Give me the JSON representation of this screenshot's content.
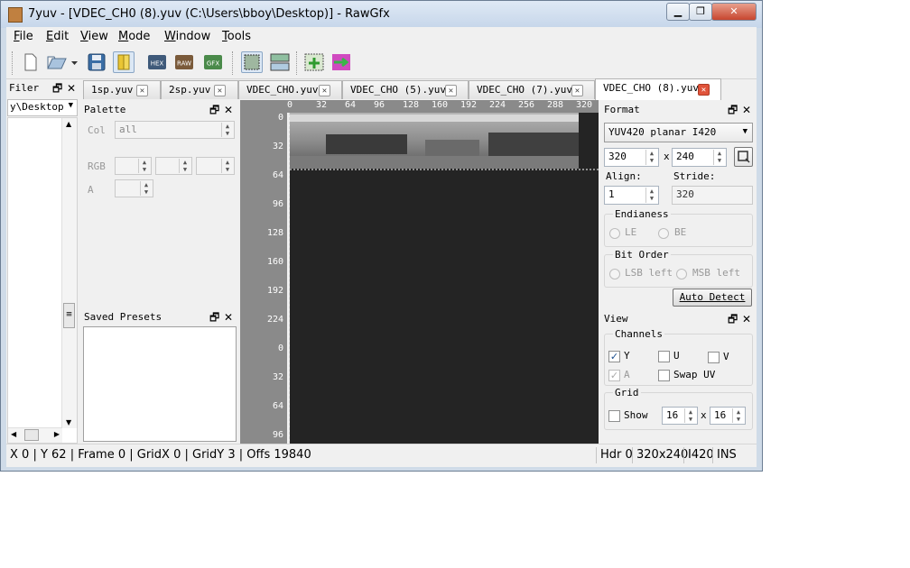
{
  "window": {
    "title": "7yuv - [VDEC_CH0 (8).yuv (C:\\Users\\bboy\\Desktop)] - RawGfx"
  },
  "menubar": {
    "items": [
      "File",
      "Edit",
      "View",
      "Mode",
      "Window",
      "Tools"
    ]
  },
  "toolbar": {
    "buttons": [
      "new-file-icon",
      "open-folder-icon",
      "dropdown-arrow-icon",
      "save-icon",
      "bookmark-icon",
      "hex-icon",
      "raw-icon",
      "gfx-icon",
      "grid-dots-icon",
      "compare-icon",
      "add-frame-icon",
      "convert-icon"
    ],
    "hex_label": "HEX",
    "raw_label": "RAW",
    "gfx_label": "GFX"
  },
  "filer": {
    "title": "Filer",
    "path": "y\\Desktop"
  },
  "palette": {
    "title": "Palette",
    "col_label": "Col",
    "col_value": "all",
    "rgb_label": "RGB",
    "a_label": "A"
  },
  "saved_presets": {
    "title": "Saved Presets"
  },
  "tabs": [
    {
      "label": "1sp.yuv"
    },
    {
      "label": "2sp.yuv"
    },
    {
      "label": "VDEC_CHO.yuv"
    },
    {
      "label": "VDEC_CHO (5).yuv"
    },
    {
      "label": "VDEC_CHO (7).yuv"
    },
    {
      "label": "VDEC_CHO (8).yuv"
    }
  ],
  "viewer": {
    "top_ticks": [
      "0",
      "32",
      "64",
      "96",
      "128",
      "160",
      "192",
      "224",
      "256",
      "288",
      "320"
    ],
    "left_ticks": [
      "0",
      "32",
      "64",
      "96",
      "128",
      "160",
      "192",
      "224",
      "0",
      "32",
      "64",
      "96"
    ]
  },
  "format": {
    "title": "Format",
    "type": "YUV420 planar I420",
    "width": "320",
    "times": "x",
    "height": "240",
    "align_label": "Align:",
    "align_value": "1",
    "stride_label": "Stride:",
    "stride_value": "320",
    "endianess_label": "Endianess",
    "le_label": "LE",
    "be_label": "BE",
    "bitorder_label": "Bit Order",
    "lsb_label": "LSB left",
    "msb_label": "MSB left",
    "auto_detect": "Auto Detect"
  },
  "view": {
    "title": "View",
    "channels_label": "Channels",
    "y_label": "Y",
    "y_checked": true,
    "u_label": "U",
    "u_checked": false,
    "v_label": "V",
    "v_checked": false,
    "a_label": "A",
    "a_checked": true,
    "swapuv_label": "Swap UV",
    "swapuv_checked": false,
    "grid_label": "Grid",
    "show_label": "Show",
    "show_checked": false,
    "grid_w": "16",
    "grid_x": "x",
    "grid_h": "16"
  },
  "statusbar": {
    "left": "X 0 | Y 62 | Frame 0 | GridX 0 | GridY 3 | Offs 19840",
    "hdr": "Hdr 0",
    "size": "320x240",
    "fmt": "I420",
    "mode": "INS"
  },
  "colors": {
    "viewer_bg": "#242424",
    "ruler": "#8a8a8a",
    "window_frame": "#cfdbe8",
    "close_red": "#e0533a"
  }
}
